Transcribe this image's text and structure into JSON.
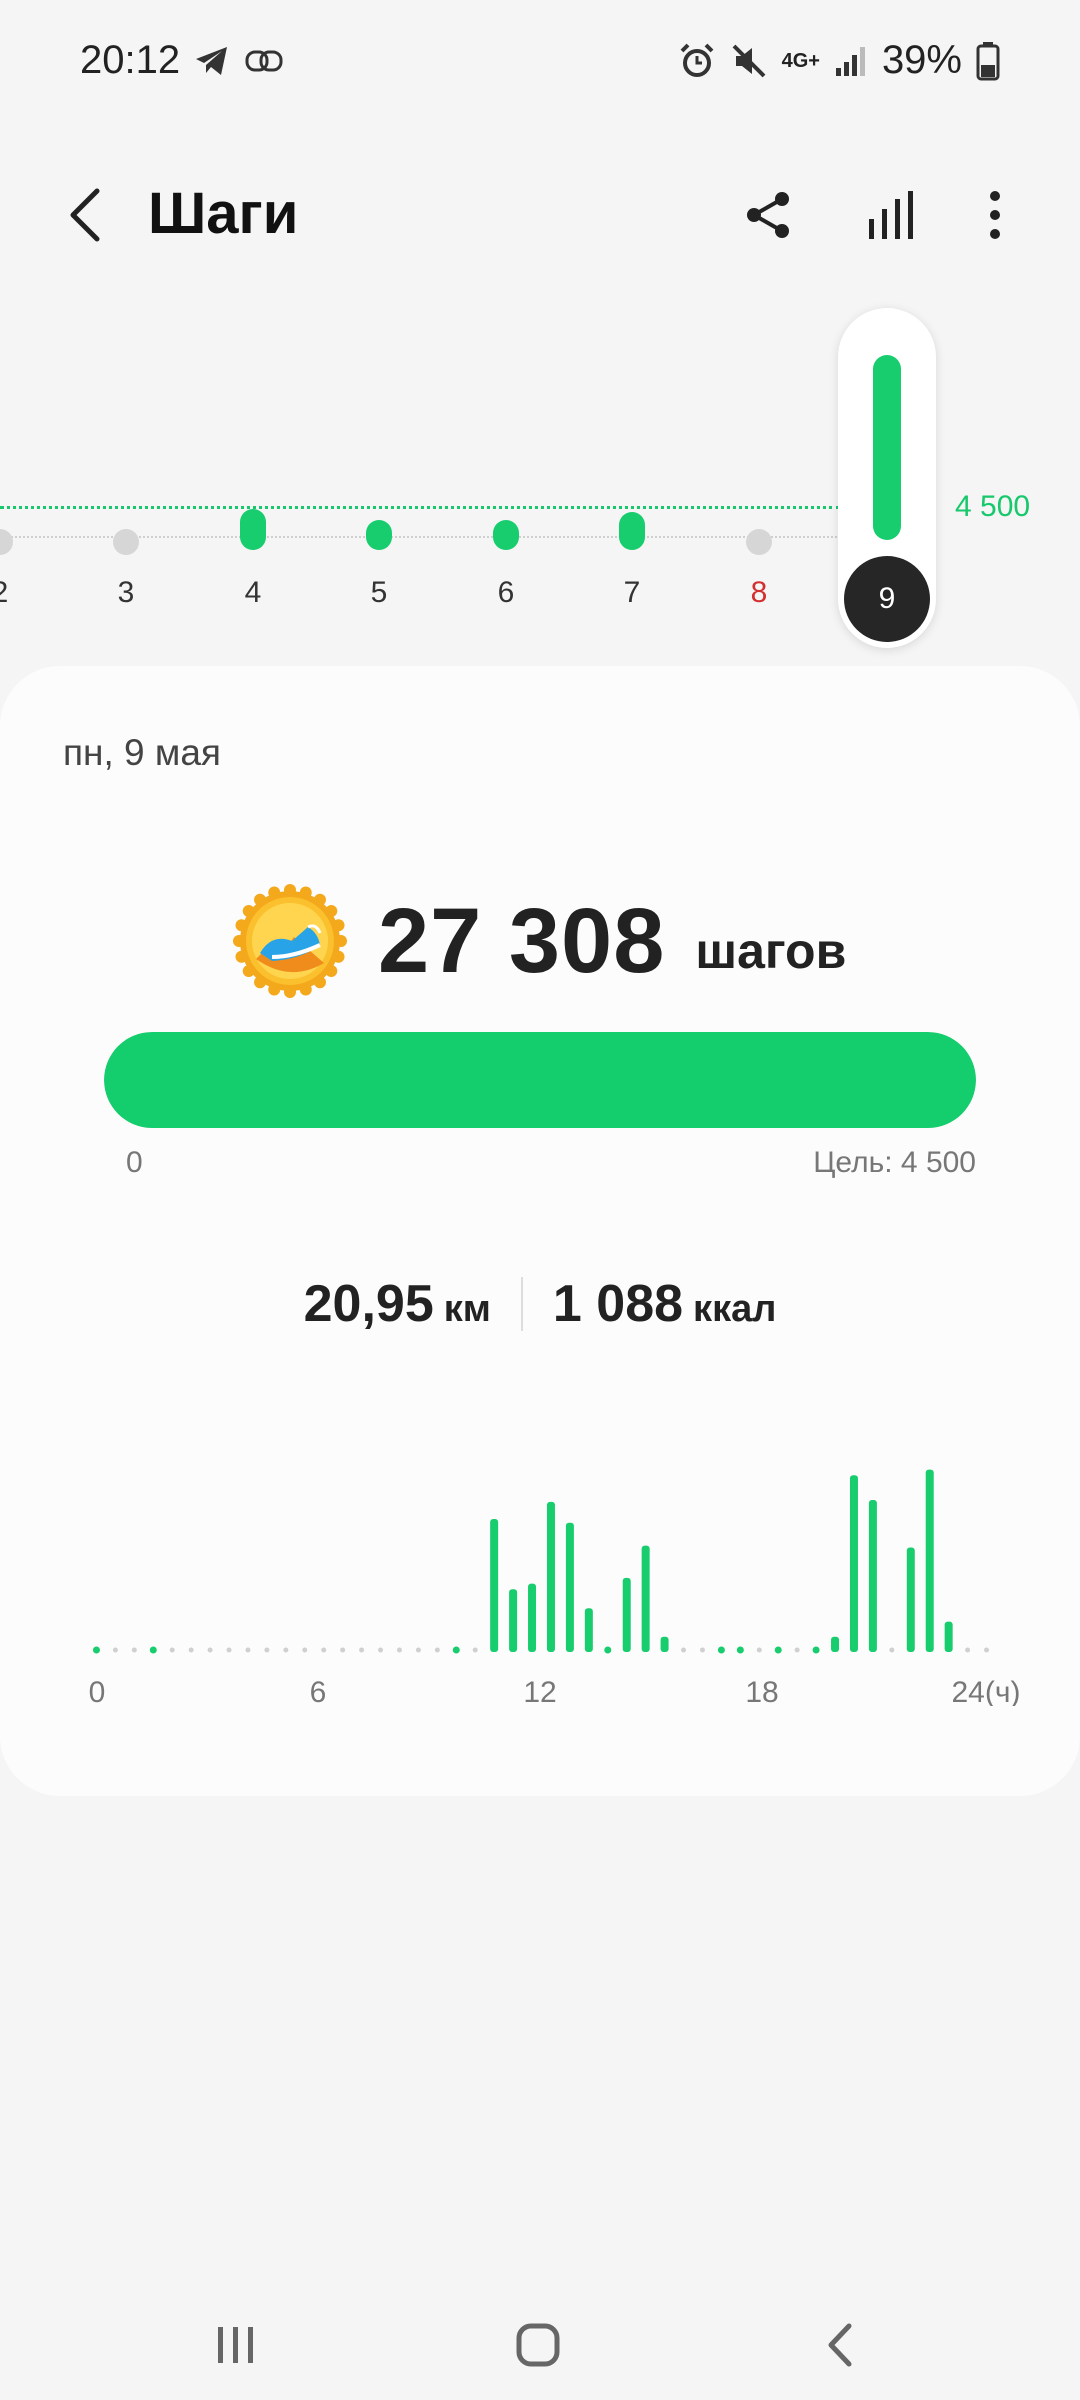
{
  "status_bar": {
    "time": "20:12",
    "network": "4G+",
    "battery": "39%"
  },
  "header": {
    "title": "Шаги",
    "icons": [
      "back-icon",
      "share-icon",
      "chart-icon",
      "more-icon"
    ]
  },
  "day_strip": {
    "goal_label": "4 500",
    "days": [
      {
        "label": "2",
        "steps_fraction": 0,
        "color": "#333333"
      },
      {
        "label": "3",
        "steps_fraction": 0,
        "color": "#333333"
      },
      {
        "label": "4",
        "steps_fraction": 0.23,
        "color": "#333333"
      },
      {
        "label": "5",
        "steps_fraction": 0.12,
        "color": "#333333"
      },
      {
        "label": "6",
        "steps_fraction": 0.16,
        "color": "#333333"
      },
      {
        "label": "7",
        "steps_fraction": 0.21,
        "color": "#333333"
      },
      {
        "label": "8",
        "steps_fraction": 0,
        "color": "#d32f2f"
      }
    ],
    "selected_day": "9"
  },
  "card": {
    "date": "пн, 9 мая",
    "steps_value": "27 308",
    "steps_unit": "шагов",
    "progress_fraction": 1.0,
    "progress_min": "0",
    "progress_goal": "Цель: 4 500",
    "distance_value": "20,95",
    "distance_unit": "км",
    "calories_value": "1 088",
    "calories_unit": "ккал"
  },
  "chart_data": {
    "type": "bar",
    "x_tick_labels": [
      "0",
      "6",
      "12",
      "18",
      "24(ч)"
    ],
    "xlim": [
      0,
      24
    ],
    "bin_hours": 0.5,
    "values": [
      0.02,
      0,
      0,
      0.02,
      0,
      0,
      0,
      0,
      0,
      0,
      0,
      0,
      0,
      0,
      0,
      0,
      0,
      0,
      0,
      0.02,
      0,
      0.7,
      0.33,
      0.36,
      0.79,
      0.68,
      0.23,
      0.02,
      0.39,
      0.56,
      0.08,
      0,
      0,
      0.02,
      0.02,
      0,
      0.02,
      0,
      0.02,
      0.08,
      0.93,
      0.8,
      0,
      0.55,
      0.96,
      0.16,
      0,
      0
    ],
    "color": "#17cd6e"
  },
  "nav_bar": {
    "icons": [
      "recents-icon",
      "home-icon",
      "back-nav-icon"
    ]
  }
}
